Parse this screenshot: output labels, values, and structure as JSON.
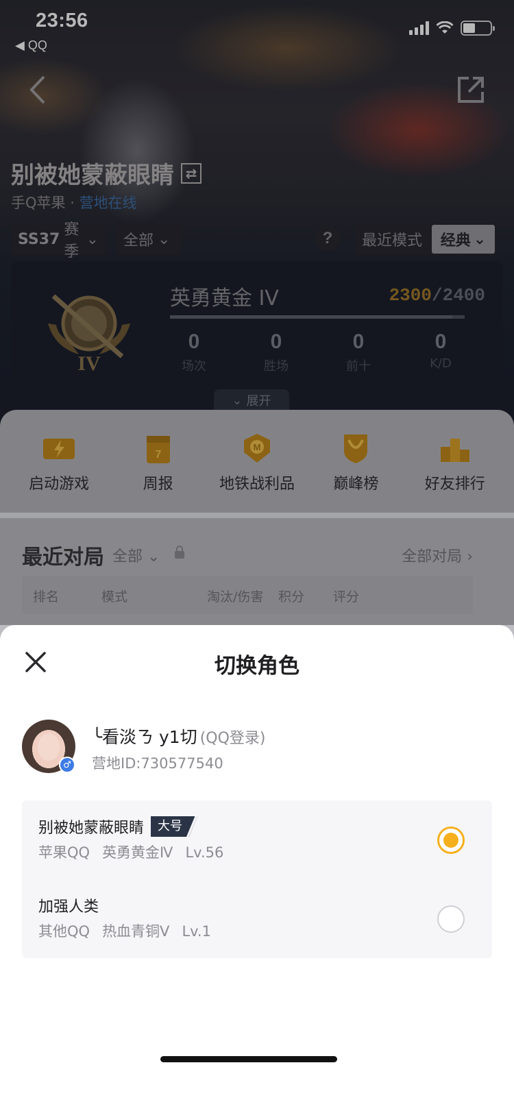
{
  "status_bar": {
    "time": "23:56",
    "back_app": "◀ QQ"
  },
  "background": {
    "title": "别被她蒙蔽眼睛",
    "subtitle_prefix": "手Q苹果 · ",
    "subtitle_link": "营地在线",
    "season_filter": {
      "season": "SS37",
      "label": "赛季"
    },
    "scope_filter": "全部",
    "help": "?",
    "mode": {
      "label": "最近模式",
      "value": "经典"
    },
    "rank": {
      "tier": "英勇黄金 IV",
      "emblem_numeral": "IV",
      "score_current": "2300",
      "score_total": "/2400",
      "progress": 0.958,
      "stats": [
        {
          "value": "0",
          "label": "场次"
        },
        {
          "value": "0",
          "label": "胜场"
        },
        {
          "value": "0",
          "label": "前十"
        },
        {
          "value": "0",
          "label": "K/D"
        }
      ],
      "expand": "展开"
    },
    "shortcuts": [
      "启动游戏",
      "周报",
      "地铁战利品",
      "巅峰榜",
      "好友排行"
    ],
    "recent": {
      "title": "最近对局",
      "filter": "全部",
      "all_link": "全部对局",
      "columns": [
        "排名",
        "模式",
        "淘汰/伤害",
        "积分",
        "评分"
      ]
    }
  },
  "sheet": {
    "title": "切换角色",
    "account": {
      "nickname": "╰看淡ㄋ y1切",
      "login_type": "(QQ登录)",
      "camp_id": "营地ID:730577540",
      "gender_icon": "♂"
    },
    "roles": [
      {
        "name": "别被她蒙蔽眼睛",
        "tag": "大号",
        "platform": "苹果QQ",
        "tier": "英勇黄金Ⅳ",
        "level": "Lv.56",
        "selected": true
      },
      {
        "name": "加强人类",
        "tag": "",
        "platform": "其他QQ",
        "tier": "热血青铜Ⅴ",
        "level": "Lv.1",
        "selected": false
      }
    ]
  },
  "colors": {
    "accent": "#f6b01d",
    "gold": "#a37a2b",
    "link": "#3f6fa8",
    "tag_bg": "#2a3446"
  }
}
